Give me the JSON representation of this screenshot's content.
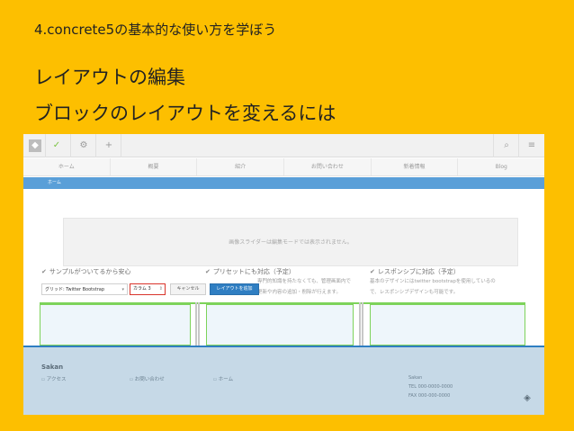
{
  "slide": {
    "header": "4.concrete5の基本的な使い方を学ぼう",
    "title_line1": "レイアウトの編集",
    "title_line2": "ブロックのレイアウトを変えるには"
  },
  "toolbar": {
    "icons": [
      "concrete5-logo-icon",
      "check-icon",
      "gear-icon",
      "plus-icon",
      "search-icon",
      "menu-icon"
    ]
  },
  "nav": {
    "items": [
      "ホーム",
      "概要",
      "紹介",
      "お問い合わせ",
      "新着情報",
      "Blog"
    ]
  },
  "breadcrumb": "ホーム",
  "slider": {
    "message": "画像スライダーは編集モードでは表示されません。"
  },
  "features": [
    {
      "title": "サンプルがついてるから安心"
    },
    {
      "title": "プリセットにも対応（予定）",
      "text1": "専門的知識を持たなくても、管理画面内で",
      "text2": "更新や内容の追加・削除が行えます。"
    },
    {
      "title": "レスポンシブに対応（予定）",
      "text1": "基本のデザインにはtwitter bootstrapを使用しているの",
      "text2": "で、レスポンシブデザインも可能です。"
    }
  ],
  "layout_toolbar": {
    "grid_label": "グリッド: Twitter Bootstrap",
    "columns_label": "カラム",
    "columns_value": "3",
    "cancel_label": "キャンセル",
    "add_label": "レイアウトを追加"
  },
  "footer": {
    "site_name": "Sakan",
    "links": [
      "アクセス",
      "お問い合わせ",
      "ホーム"
    ],
    "info_name": "Sakan",
    "tel": "TEL 000-0000-0000",
    "fax": "FAX 000-000-0000"
  },
  "colors": {
    "slide_background": "#FDBF00",
    "breadcrumb_bar": "#5a9fd8",
    "primary_button": "#2f7ec2",
    "columns_highlight": "#d9342b",
    "layout_outline": "#7dd35a",
    "footer_bg": "#c6d9e7"
  }
}
